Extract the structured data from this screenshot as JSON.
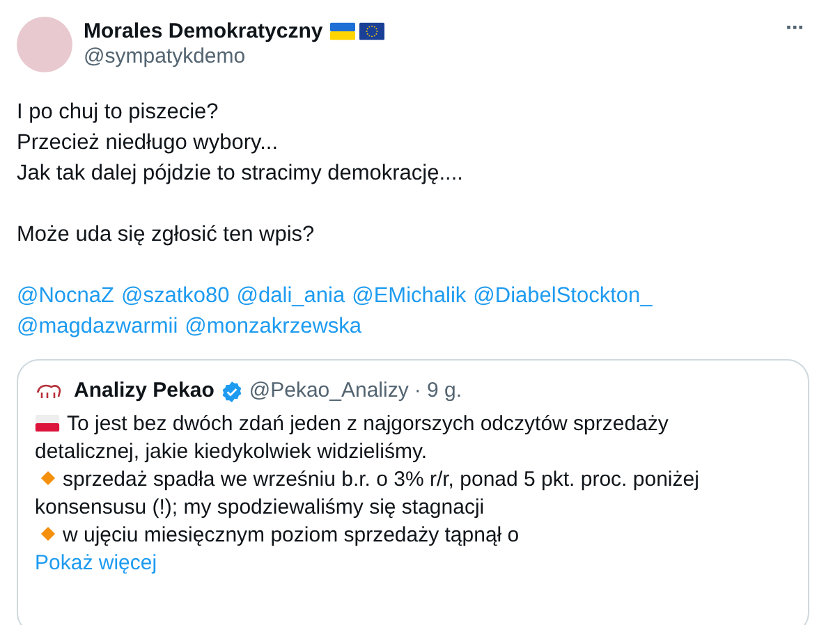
{
  "author": {
    "name": "Morales Demokratyczny",
    "handle": "@sympatykdemo",
    "flags": [
      {
        "kind": "ua"
      },
      {
        "kind": "eu"
      }
    ]
  },
  "more": "···",
  "text_paragraphs": [
    [
      "I po chuj to piszecie?",
      "Przecież niedługo wybory...",
      "Jak tak dalej pójdzie to stracimy demokrację...."
    ],
    [
      "Może uda się zgłosić ten wpis?"
    ]
  ],
  "mention_lines": [
    [
      "@NocnaZ",
      "@szatko80",
      "@dali_ania",
      "@EMichalik",
      "@DiabelStockton_"
    ],
    [
      "@magdazwarmii",
      "@monzakrzewska"
    ]
  ],
  "quote": {
    "name": "Analizy Pekao",
    "verified": true,
    "handle": "@Pekao_Analizy",
    "time": "· 9 g.",
    "paragraphs": [
      {
        "kind": "flag",
        "text": "To jest bez dwóch zdań jeden z najgorszych odczytów sprzedaży detalicznej, jakie kiedykolwiek widzieliśmy."
      },
      {
        "kind": "bullet",
        "text": "sprzedaż spadła we wrześniu b.r. o 3% r/r, ponad 5 pkt. proc. poniżej konsensusu (!); my spodziewaliśmy się stagnacji"
      },
      {
        "kind": "bullet",
        "text": "w ujęciu miesięcznym poziom sprzedaży tąpnął o"
      }
    ],
    "show_more": "Pokaż więcej"
  }
}
